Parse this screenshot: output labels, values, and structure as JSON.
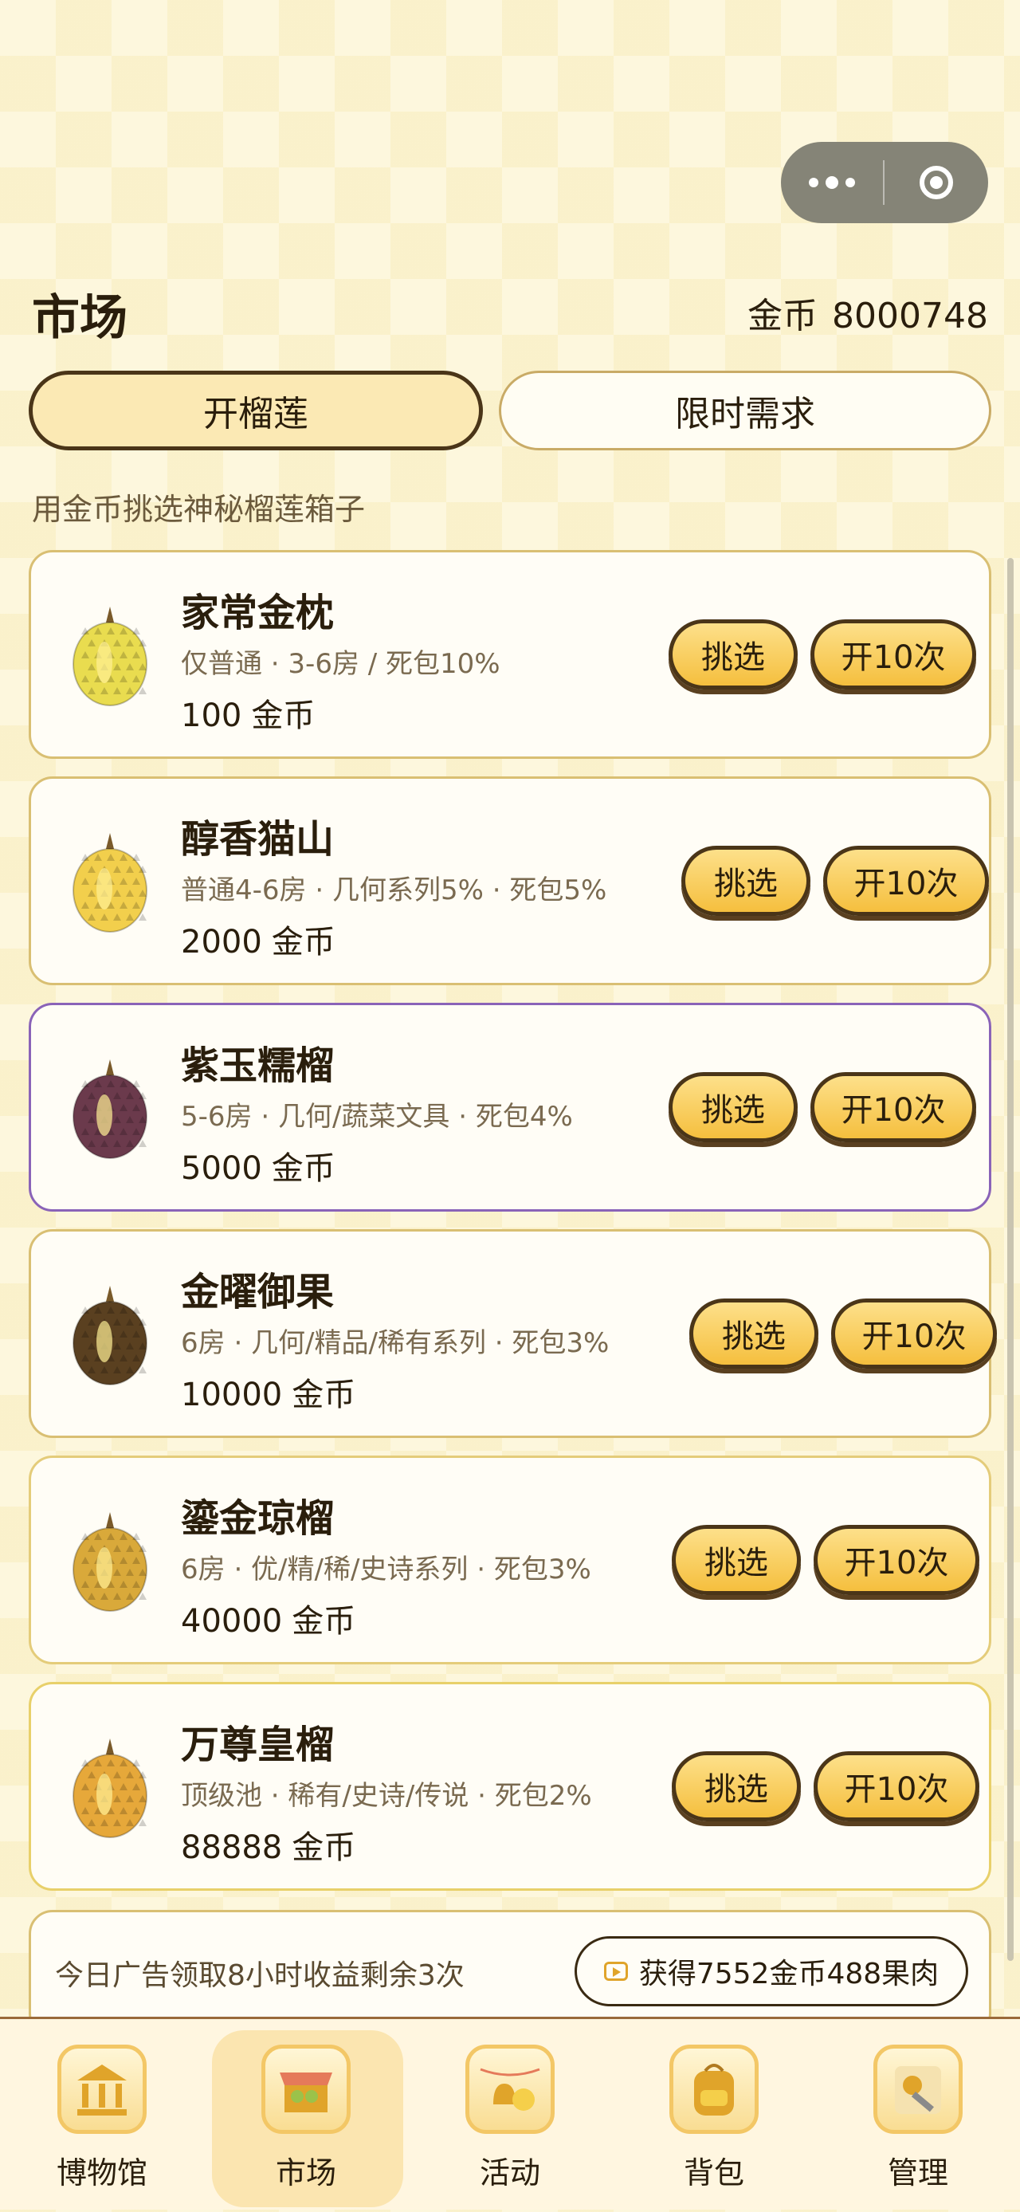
{
  "header": {
    "title": "市场",
    "coin_label": "金币",
    "coin_value": "8000748"
  },
  "tabs": [
    {
      "label": "开榴莲",
      "active": true
    },
    {
      "label": "限时需求",
      "active": false
    }
  ],
  "subtitle": "用金币挑选神秘榴莲箱子",
  "boxes": [
    {
      "name": "家常金枕",
      "desc": "仅普通 · 3-6房 / 死包10%",
      "price": "100",
      "currency": "金币",
      "pick_label": "挑选",
      "open_label": "开10次",
      "fruit_color": "#e9dc4f",
      "border": "#d9bf73"
    },
    {
      "name": "醇香猫山",
      "desc": "普通4-6房 · 几何系列5% · 死包5%",
      "price": "2000",
      "currency": "金币",
      "pick_label": "挑选",
      "open_label": "开10次",
      "fruit_color": "#f2cf4c",
      "border": "#d9bf73"
    },
    {
      "name": "紫玉糯榴",
      "desc": "5-6房 · 几何/蔬菜文具 · 死包4%",
      "price": "5000",
      "currency": "金币",
      "pick_label": "挑选",
      "open_label": "开10次",
      "fruit_color": "#6b3a4c",
      "border": "#8a63b8"
    },
    {
      "name": "金曜御果",
      "desc": "6房 · 几何/精品/稀有系列 · 死包3%",
      "price": "10000",
      "currency": "金币",
      "pick_label": "挑选",
      "open_label": "开10次",
      "fruit_color": "#5a4020",
      "border": "#d9bf73"
    },
    {
      "name": "鎏金琼榴",
      "desc": "6房 · 优/精/稀/史诗系列 · 死包3%",
      "price": "40000",
      "currency": "金币",
      "pick_label": "挑选",
      "open_label": "开10次",
      "fruit_color": "#d9a93a",
      "border": "#e4cc7a"
    },
    {
      "name": "万尊皇榴",
      "desc": "顶级池 · 稀有/史诗/传说 · 死包2%",
      "price": "88888",
      "currency": "金币",
      "pick_label": "挑选",
      "open_label": "开10次",
      "fruit_color": "#e6a83a",
      "border": "#e8d06a"
    }
  ],
  "ad": {
    "text": "今日广告领取8小时收益剩余3次",
    "button": "获得7552金币488果肉"
  },
  "nav": [
    {
      "label": "博物馆",
      "icon": "museum-icon",
      "active": false
    },
    {
      "label": "市场",
      "icon": "market-stall-icon",
      "active": true
    },
    {
      "label": "活动",
      "icon": "event-bell-icon",
      "active": false
    },
    {
      "label": "背包",
      "icon": "backpack-icon",
      "active": false
    },
    {
      "label": "管理",
      "icon": "wrench-gear-icon",
      "active": false
    }
  ]
}
